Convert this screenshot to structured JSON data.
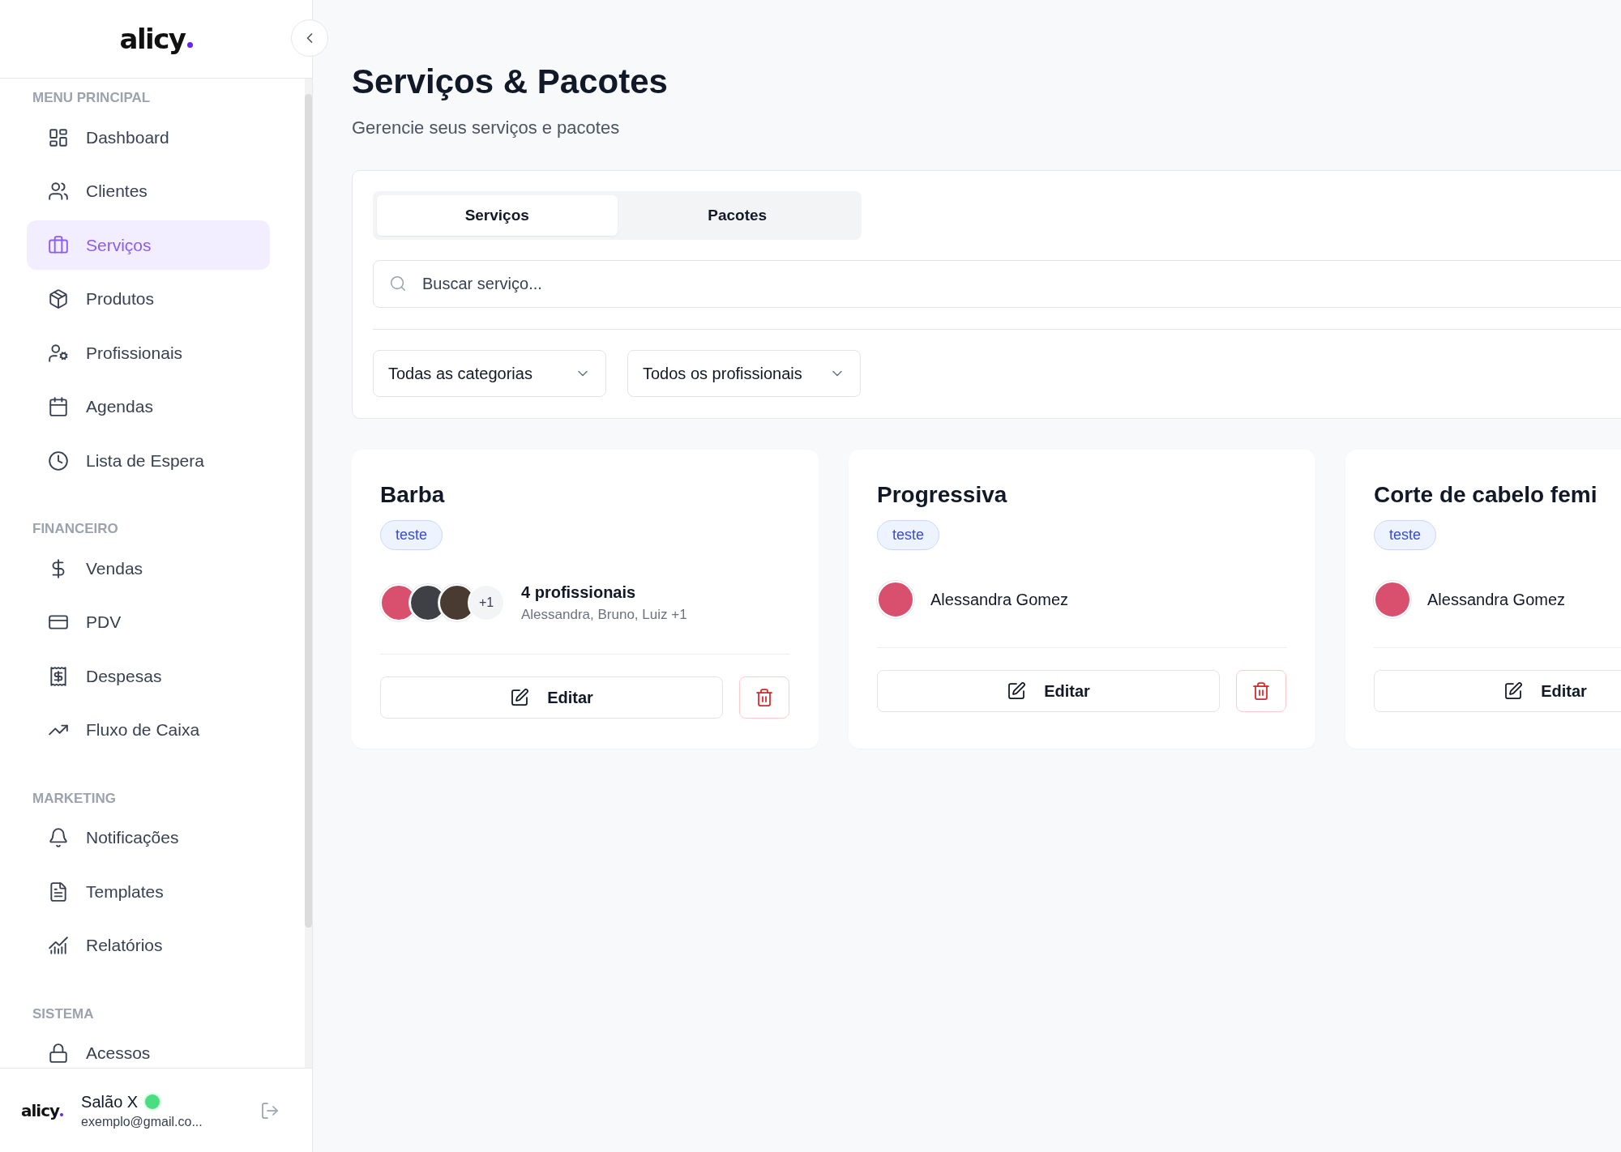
{
  "sidebar": {
    "logo": "alicy",
    "sections": [
      {
        "title": "MENU PRINCIPAL",
        "items": [
          {
            "label": "Dashboard",
            "selected": false
          },
          {
            "label": "Clientes",
            "selected": false
          },
          {
            "label": "Serviços",
            "selected": true
          },
          {
            "label": "Produtos",
            "selected": false
          },
          {
            "label": "Profissionais",
            "selected": false
          },
          {
            "label": "Agendas",
            "selected": false
          },
          {
            "label": "Lista de Espera",
            "selected": false
          }
        ]
      },
      {
        "title": "FINANCEIRO",
        "items": [
          {
            "label": "Vendas",
            "selected": false
          },
          {
            "label": "PDV",
            "selected": false
          },
          {
            "label": "Despesas",
            "selected": false
          },
          {
            "label": "Fluxo de Caixa",
            "selected": false
          }
        ]
      },
      {
        "title": "MARKETING",
        "items": [
          {
            "label": "Notificações",
            "selected": false
          },
          {
            "label": "Templates",
            "selected": false
          },
          {
            "label": "Relatórios",
            "selected": false
          }
        ]
      },
      {
        "title": "SISTEMA",
        "items": [
          {
            "label": "Acessos",
            "selected": false
          }
        ]
      }
    ],
    "footer": {
      "logo": "alicy",
      "name": "Salão X",
      "online": true,
      "email": "exemplo@gmail.co..."
    }
  },
  "page": {
    "title": "Serviços & Pacotes",
    "subtitle": "Gerencie seus serviços e pacotes"
  },
  "tabs": [
    {
      "label": "Serviços",
      "selected": true
    },
    {
      "label": "Pacotes",
      "selected": false
    }
  ],
  "search": {
    "placeholder": "Buscar serviço..."
  },
  "filters": [
    {
      "value": "Todas as categorias"
    },
    {
      "value": "Todos os profissionais"
    }
  ],
  "cards": [
    {
      "title": "Barba",
      "tag": "teste",
      "professionals": {
        "kind": "group",
        "avatars": [
          {
            "color": "#d8506e"
          },
          {
            "color": "#3f3f46"
          },
          {
            "color": "#4a3b32"
          }
        ],
        "more": "+1",
        "count": "4 profissionais",
        "names": "Alessandra, Bruno, Luiz +1"
      },
      "buttons": [
        {
          "kind": "edit",
          "label": "Editar"
        },
        {
          "kind": "delete"
        }
      ]
    },
    {
      "title": "Progressiva",
      "tag": "teste",
      "professionals": {
        "kind": "single",
        "avatars": [
          {
            "color": "#d8506e"
          }
        ],
        "name": "Alessandra Gomez"
      },
      "buttons": [
        {
          "kind": "edit",
          "label": "Editar"
        },
        {
          "kind": "delete"
        }
      ]
    },
    {
      "title": "Corte de cabelo femi",
      "tag": "teste",
      "professionals": {
        "kind": "single",
        "avatars": [
          {
            "color": "#d8506e"
          }
        ],
        "name": "Alessandra Gomez"
      },
      "buttons": [
        {
          "kind": "edit",
          "label": "Editar"
        }
      ]
    }
  ]
}
